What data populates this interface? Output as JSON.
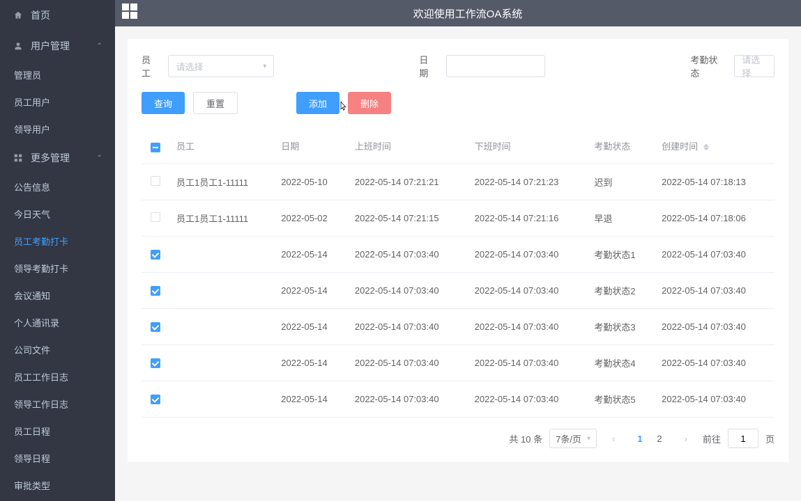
{
  "topbar": {
    "title": "欢迎使用工作流OA系统"
  },
  "sidebar": {
    "home": "首页",
    "user_mgmt": "用户管理",
    "user_children": [
      "管理员",
      "员工用户",
      "领导用户"
    ],
    "more_mgmt": "更多管理",
    "more_children": [
      "公告信息",
      "今日天气",
      "员工考勤打卡",
      "领导考勤打卡",
      "会议通知",
      "个人通讯录",
      "公司文件",
      "员工工作日志",
      "领导工作日志",
      "员工日程",
      "领导日程",
      "审批类型"
    ],
    "active_index": 2
  },
  "filters": {
    "employee_label": "员工",
    "employee_placeholder": "请选择",
    "date_label": "日期",
    "status_label": "考勤状态",
    "status_placeholder": "请选择"
  },
  "buttons": {
    "search": "查询",
    "reset": "重置",
    "add": "添加",
    "delete": "删除"
  },
  "table": {
    "headers": {
      "employee": "员工",
      "date": "日期",
      "on_time": "上班时间",
      "off_time": "下班时间",
      "status": "考勤状态",
      "created": "创建时间"
    },
    "rows": [
      {
        "checked": false,
        "employee": "员工1员工1-11111",
        "date": "2022-05-10",
        "on": "2022-05-14 07:21:21",
        "off": "2022-05-14 07:21:23",
        "status": "迟到",
        "created": "2022-05-14 07:18:13"
      },
      {
        "checked": false,
        "employee": "员工1员工1-11111",
        "date": "2022-05-02",
        "on": "2022-05-14 07:21:15",
        "off": "2022-05-14 07:21:16",
        "status": "早退",
        "created": "2022-05-14 07:18:06"
      },
      {
        "checked": true,
        "employee": "",
        "date": "2022-05-14",
        "on": "2022-05-14 07:03:40",
        "off": "2022-05-14 07:03:40",
        "status": "考勤状态1",
        "created": "2022-05-14 07:03:40"
      },
      {
        "checked": true,
        "employee": "",
        "date": "2022-05-14",
        "on": "2022-05-14 07:03:40",
        "off": "2022-05-14 07:03:40",
        "status": "考勤状态2",
        "created": "2022-05-14 07:03:40"
      },
      {
        "checked": true,
        "employee": "",
        "date": "2022-05-14",
        "on": "2022-05-14 07:03:40",
        "off": "2022-05-14 07:03:40",
        "status": "考勤状态3",
        "created": "2022-05-14 07:03:40"
      },
      {
        "checked": true,
        "employee": "",
        "date": "2022-05-14",
        "on": "2022-05-14 07:03:40",
        "off": "2022-05-14 07:03:40",
        "status": "考勤状态4",
        "created": "2022-05-14 07:03:40"
      },
      {
        "checked": true,
        "employee": "",
        "date": "2022-05-14",
        "on": "2022-05-14 07:03:40",
        "off": "2022-05-14 07:03:40",
        "status": "考勤状态5",
        "created": "2022-05-14 07:03:40"
      }
    ]
  },
  "pagination": {
    "total_text": "共 10 条",
    "page_size": "7条/页",
    "pages": [
      "1",
      "2"
    ],
    "current": "1",
    "goto_prefix": "前往",
    "goto_value": "1",
    "goto_suffix": "页"
  }
}
